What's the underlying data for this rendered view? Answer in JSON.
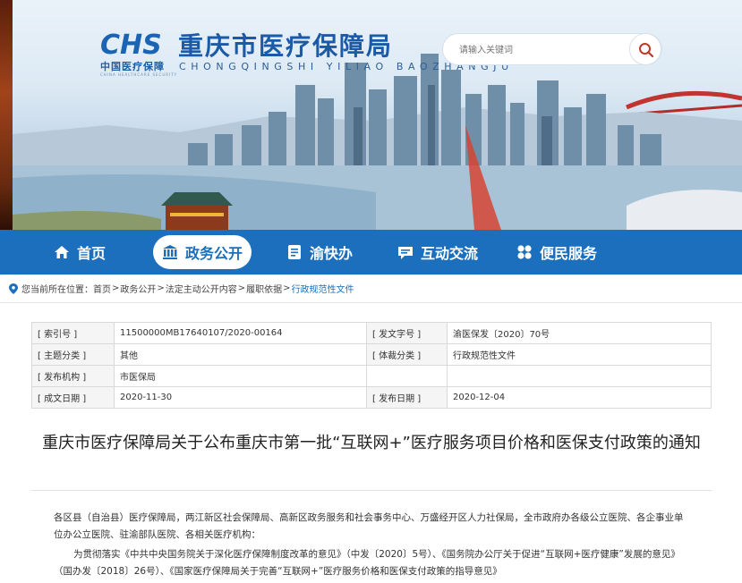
{
  "header": {
    "logo_mark": "CHS",
    "logo_sub": "中国医疗保障",
    "logo_sub_en": "CHINA HEALTHCARE SECURITY",
    "title": "重庆市医疗保障局",
    "title_en": "CHONGQINGSHI YILIAO BAOZHANGJU",
    "search_placeholder": "请输入关键词"
  },
  "nav": {
    "items": [
      {
        "label": "首页",
        "icon": "home-icon"
      },
      {
        "label": "政务公开",
        "icon": "bank-icon"
      },
      {
        "label": "渝快办",
        "icon": "document-icon"
      },
      {
        "label": "互动交流",
        "icon": "chat-icon"
      },
      {
        "label": "便民服务",
        "icon": "grid-icon"
      }
    ],
    "active_index": 1
  },
  "breadcrumb": {
    "prefix": "您当前所在位置：",
    "items": [
      "首页",
      "政务公开",
      "法定主动公开内容",
      "履职依据",
      "行政规范性文件"
    ],
    "separator": ">"
  },
  "meta": {
    "index_no_label": "[ 索引号 ]",
    "index_no": "11500000MB17640107/2020-00164",
    "doc_no_label": "[ 发文字号 ]",
    "doc_no": "渝医保发〔2020〕70号",
    "topic_label": "[ 主题分类 ]",
    "topic": "其他",
    "genre_label": "[ 体裁分类 ]",
    "genre": "行政规范性文件",
    "issuer_label": "[ 发布机构 ]",
    "issuer": "市医保局",
    "created_label": "[ 成文日期 ]",
    "created": "2020-11-30",
    "published_label": "[ 发布日期 ]",
    "published": "2020-12-04"
  },
  "article": {
    "title": "重庆市医疗保障局关于公布重庆市第一批“互联网+”医疗服务项目价格和医保支付政策的通知",
    "addressee": "各区县（自治县）医疗保障局，两江新区社会保障局、高新区政务服务和社会事务中心、万盛经开区人力社保局，全市政府办各级公立医院、各企事业单位办公立医院、驻渝部队医院、各相关医疗机构：",
    "para1": "为贯彻落实《中共中央国务院关于深化医疗保障制度改革的意见》（中发〔2020〕5号）、《国务院办公厅关于促进“互联网+医疗健康”发展的意见》（国办发〔2018〕26号）、《国家医疗保障局关于完善“互联网+”医疗服务价格和医保支付政策的指导意见》"
  }
}
